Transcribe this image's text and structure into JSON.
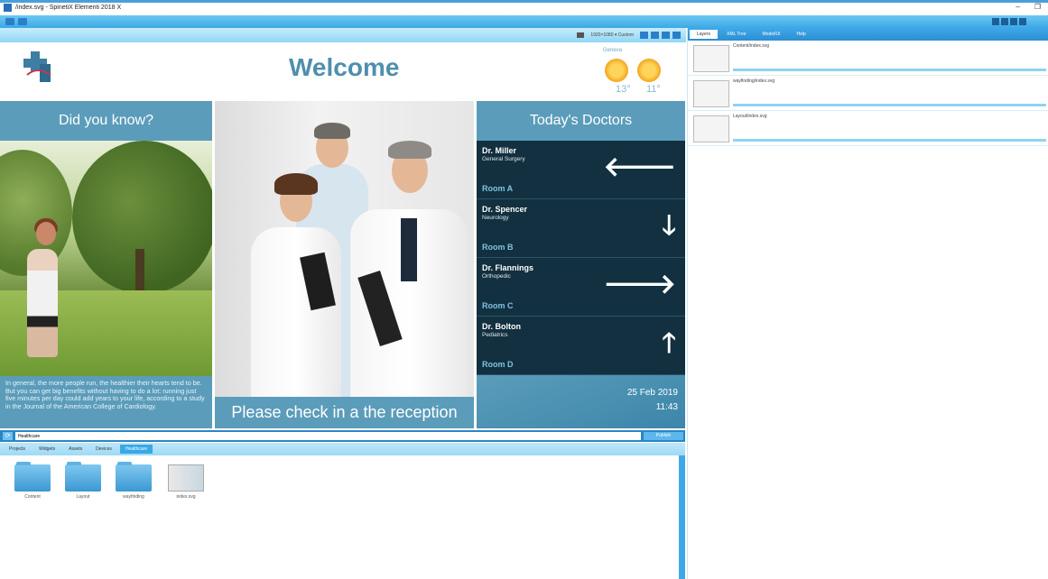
{
  "window": {
    "title": "/index.svg - SpinetiX Elementi 2018 X"
  },
  "subbar": {
    "zoom_text": "1920×1080 ▾ Custom"
  },
  "signage": {
    "welcome": "Welcome",
    "weather": {
      "label": "Geneva",
      "temp1": "13°",
      "temp2": "11°"
    },
    "did_you_know": {
      "title": "Did you know?",
      "text": "In general, the more people run, the healthier their hearts tend to be. But you can get big benefits without having to do a lot: running just five minutes per day could add years to your life, according to a study in the Journal of the American College of Cardiology."
    },
    "caption": "Please check in a the reception",
    "doctors": {
      "title": "Today's Doctors",
      "rows": [
        {
          "name": "Dr. Miller",
          "specialty": "General Surgery",
          "room": "Room A",
          "arrow": "🡐"
        },
        {
          "name": "Dr. Spencer",
          "specialty": "Neurology",
          "room": "Room B",
          "arrow": "🡓"
        },
        {
          "name": "Dr. Flannings",
          "specialty": "Orthopedic",
          "room": "Room C",
          "arrow": "🡒"
        },
        {
          "name": "Dr. Bolton",
          "specialty": "Pediatrics",
          "room": "Room D",
          "arrow": "🡑"
        }
      ],
      "date": "25 Feb 2019",
      "time": "11:43"
    }
  },
  "address": {
    "value": "Healthcare",
    "publish": "Publish"
  },
  "bottom_tabs": [
    "Projects",
    "Widgets",
    "Assets",
    "Devices",
    "Healthcare"
  ],
  "files": [
    {
      "label": "Content",
      "kind": "folder"
    },
    {
      "label": "Layout",
      "kind": "folder"
    },
    {
      "label": "wayfinding",
      "kind": "folder"
    },
    {
      "label": "index.svg",
      "kind": "file"
    }
  ],
  "right_tabs": [
    "Layers",
    "XML Tree",
    "Model/UI",
    "Help"
  ],
  "layers": [
    {
      "name": "Content/index.svg"
    },
    {
      "name": "wayfinding/index.svg"
    },
    {
      "name": "Layout/index.svg"
    }
  ]
}
